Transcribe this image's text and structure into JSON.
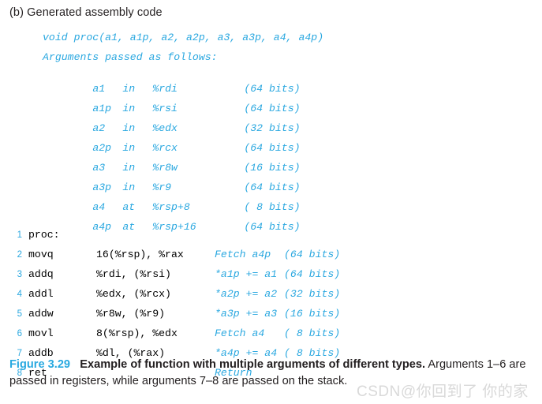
{
  "heading": "(b) Generated assembly code",
  "signature": "void proc(a1, a1p, a2, a2p, a3, a3p, a4, a4p)",
  "args_intro": "Arguments passed as follows:",
  "arguments": [
    {
      "name": "a1",
      "loc": "in",
      "reg": "%rdi",
      "bits": "(64 bits)"
    },
    {
      "name": "a1p",
      "loc": "in",
      "reg": "%rsi",
      "bits": "(64 bits)"
    },
    {
      "name": "a2",
      "loc": "in",
      "reg": "%edx",
      "bits": "(32 bits)"
    },
    {
      "name": "a2p",
      "loc": "in",
      "reg": "%rcx",
      "bits": "(64 bits)"
    },
    {
      "name": "a3",
      "loc": "in",
      "reg": "%r8w",
      "bits": "(16 bits)"
    },
    {
      "name": "a3p",
      "loc": "in",
      "reg": "%r9",
      "bits": "(64 bits)"
    },
    {
      "name": "a4",
      "loc": "at",
      "reg": "%rsp+8",
      "bits": "( 8 bits)"
    },
    {
      "name": "a4p",
      "loc": "at",
      "reg": "%rsp+16",
      "bits": "(64 bits)"
    }
  ],
  "assembly": [
    {
      "n": "1",
      "mnemonic": "proc:",
      "operands": "",
      "comment": "",
      "bits": ""
    },
    {
      "n": "2",
      "mnemonic": "movq",
      "operands": "16(%rsp), %rax",
      "comment": "Fetch a4p",
      "bits": "(64 bits)"
    },
    {
      "n": "3",
      "mnemonic": "addq",
      "operands": "%rdi, (%rsi)",
      "comment": "*a1p += a1",
      "bits": "(64 bits)"
    },
    {
      "n": "4",
      "mnemonic": "addl",
      "operands": "%edx, (%rcx)",
      "comment": "*a2p += a2",
      "bits": "(32 bits)"
    },
    {
      "n": "5",
      "mnemonic": "addw",
      "operands": "%r8w, (%r9)",
      "comment": "*a3p += a3",
      "bits": "(16 bits)"
    },
    {
      "n": "6",
      "mnemonic": "movl",
      "operands": "8(%rsp), %edx",
      "comment": "Fetch a4",
      "bits": "( 8 bits)"
    },
    {
      "n": "7",
      "mnemonic": "addb",
      "operands": "%dl, (%rax)",
      "comment": "*a4p += a4",
      "bits": "( 8 bits)"
    },
    {
      "n": "8",
      "mnemonic": "ret",
      "operands": "",
      "comment": "Return",
      "bits": ""
    }
  ],
  "caption": {
    "label": "Figure 3.29",
    "title": "Example of function with multiple arguments of different types.",
    "body": "Arguments 1–6 are passed in registers, while arguments 7–8 are passed on the stack."
  },
  "watermark": "CSDN@你回到了 你的家",
  "colors": {
    "accent_blue": "#2BA8E0",
    "figure_label_blue": "#29A9E0",
    "text_black": "#231f20",
    "watermark_gray": "#d9d9d9",
    "background": "#ffffff"
  }
}
